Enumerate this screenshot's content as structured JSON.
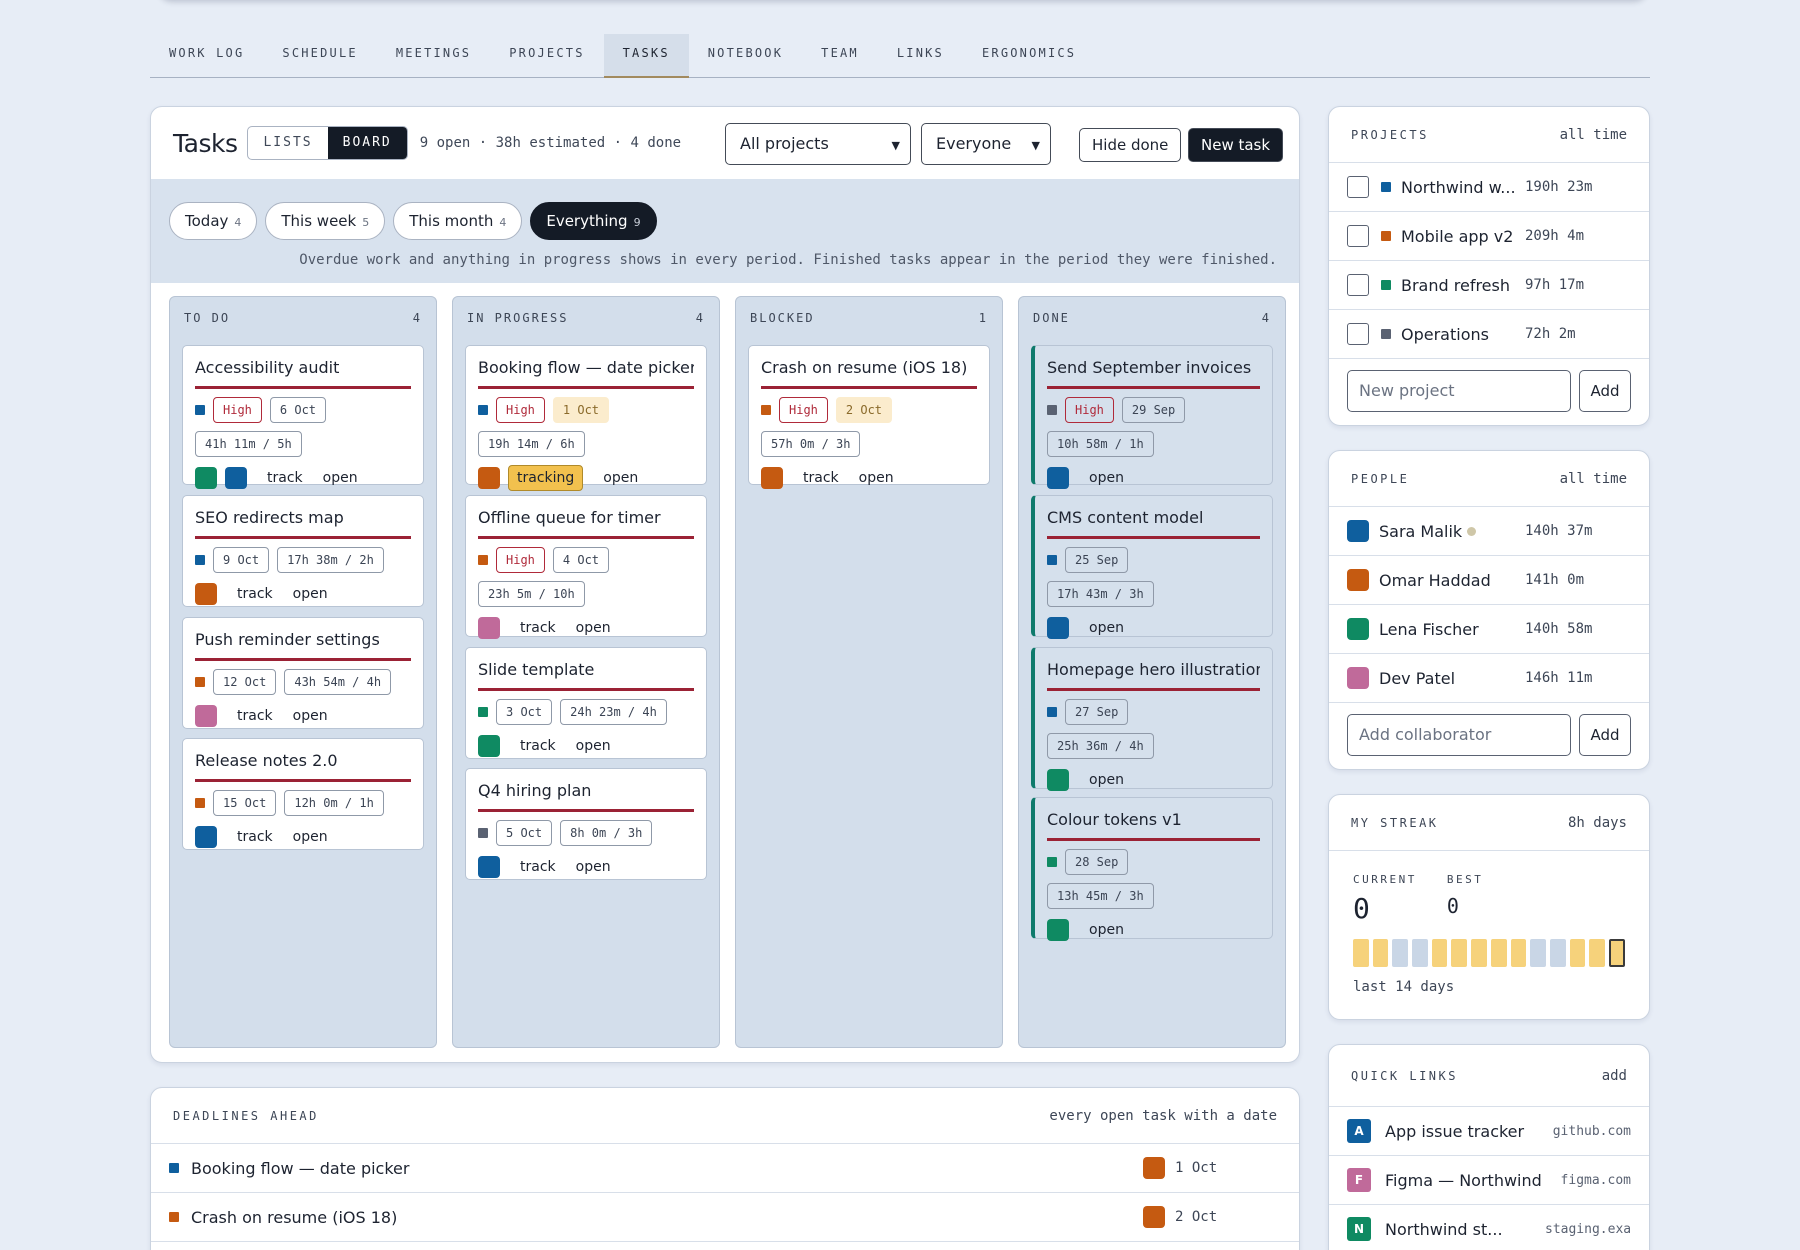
{
  "nav": [
    "WORK LOG",
    "SCHEDULE",
    "MEETINGS",
    "PROJECTS",
    "TASKS",
    "NOTEBOOK",
    "TEAM",
    "LINKS",
    "ERGONOMICS"
  ],
  "nav_active": "TASKS",
  "tasks": {
    "title": "Tasks",
    "view_lists": "LISTS",
    "view_board": "BOARD",
    "summary": "9 open · 38h estimated · 4 done",
    "project_select": "All projects",
    "people_select": "Everyone",
    "hide_done": "Hide done",
    "new_task": "New task",
    "pills": [
      {
        "label": "Today",
        "count": "4"
      },
      {
        "label": "This week",
        "count": "5"
      },
      {
        "label": "This month",
        "count": "4"
      },
      {
        "label": "Everything",
        "count": "9"
      }
    ],
    "note": "Overdue work and anything in progress shows in every period. Finished tasks appear in the period they were finished."
  },
  "columns": [
    {
      "name": "TO DO",
      "count": "4",
      "cards": [
        {
          "title": "Accessibility audit",
          "project_color": "#0f5f9e",
          "priority": "High",
          "date": "6 Oct",
          "time": "41h 11m / 5h",
          "avatars": [
            "#0f8a62",
            "#0f5f9e"
          ],
          "track": "track",
          "open": "open"
        },
        {
          "title": "SEO redirects map",
          "project_color": "#0f5f9e",
          "date": "9 Oct",
          "time": "17h 38m / 2h",
          "avatars": [
            "#c55a11"
          ],
          "track": "track",
          "open": "open"
        },
        {
          "title": "Push reminder settings",
          "project_color": "#c55a11",
          "date": "12 Oct",
          "time": "43h 54m / 4h",
          "avatars": [
            "#c06a9a"
          ],
          "track": "track",
          "open": "open"
        },
        {
          "title": "Release notes 2.0",
          "project_color": "#c55a11",
          "date": "15 Oct",
          "time": "12h 0m / 1h",
          "avatars": [
            "#0f5f9e"
          ],
          "track": "track",
          "open": "open"
        }
      ]
    },
    {
      "name": "IN PROGRESS",
      "count": "4",
      "cards": [
        {
          "title": "Booking flow — date picker",
          "project_color": "#0f5f9e",
          "priority": "High",
          "date": "1 Oct",
          "date_warn": true,
          "time": "19h 14m / 6h",
          "avatars": [
            "#c55a11"
          ],
          "tracking": "tracking",
          "open": "open"
        },
        {
          "title": "Offline queue for timer",
          "project_color": "#c55a11",
          "priority": "High",
          "date": "4 Oct",
          "time": "23h 5m / 10h",
          "avatars": [
            "#c06a9a"
          ],
          "track": "track",
          "open": "open"
        },
        {
          "title": "Slide template",
          "project_color": "#0f8a62",
          "date": "3 Oct",
          "time": "24h 23m / 4h",
          "avatars": [
            "#0f8a62"
          ],
          "track": "track",
          "open": "open"
        },
        {
          "title": "Q4 hiring plan",
          "project_color": "#5a6272",
          "date": "5 Oct",
          "time": "8h 0m / 3h",
          "avatars": [
            "#0f5f9e"
          ],
          "track": "track",
          "open": "open"
        }
      ]
    },
    {
      "name": "BLOCKED",
      "count": "1",
      "cards": [
        {
          "title": "Crash on resume (iOS 18)",
          "project_color": "#c55a11",
          "priority": "High",
          "date": "2 Oct",
          "date_warn": true,
          "time": "57h 0m / 3h",
          "avatars": [
            "#c55a11"
          ],
          "track": "track",
          "open": "open"
        }
      ]
    },
    {
      "name": "DONE",
      "count": "4",
      "cards": [
        {
          "title": "Send September invoices",
          "project_color": "#5a6272",
          "priority": "High",
          "date": "29 Sep",
          "time": "10h 58m / 1h",
          "avatars": [
            "#0f5f9e"
          ],
          "open": "open"
        },
        {
          "title": "CMS content model",
          "project_color": "#0f5f9e",
          "date": "25 Sep",
          "time": "17h 43m / 3h",
          "avatars": [
            "#0f5f9e"
          ],
          "open": "open"
        },
        {
          "title": "Homepage hero illustration",
          "project_color": "#0f5f9e",
          "date": "27 Sep",
          "time": "25h 36m / 4h",
          "avatars": [
            "#0f8a62"
          ],
          "open": "open"
        },
        {
          "title": "Colour tokens v1",
          "project_color": "#0f8a62",
          "date": "28 Sep",
          "time": "13h 45m / 3h",
          "avatars": [
            "#0f8a62"
          ],
          "open": "open"
        }
      ]
    }
  ],
  "projects": {
    "header": "PROJECTS",
    "scope": "all time",
    "items": [
      {
        "name": "Northwind w...",
        "color": "#0f5f9e",
        "hours": "190h 23m"
      },
      {
        "name": "Mobile app v2",
        "color": "#c55a11",
        "hours": "209h 4m"
      },
      {
        "name": "Brand refresh",
        "color": "#0f8a62",
        "hours": "97h 17m"
      },
      {
        "name": "Operations",
        "color": "#5a6272",
        "hours": "72h 2m"
      }
    ],
    "placeholder": "New project",
    "add": "Add"
  },
  "people": {
    "header": "PEOPLE",
    "scope": "all time",
    "items": [
      {
        "name": "Sara Malik",
        "color": "#0f5f9e",
        "hours": "140h 37m",
        "online": true
      },
      {
        "name": "Omar Haddad",
        "color": "#c55a11",
        "hours": "141h 0m"
      },
      {
        "name": "Lena Fischer",
        "color": "#0f8a62",
        "hours": "140h 58m"
      },
      {
        "name": "Dev Patel",
        "color": "#c06a9a",
        "hours": "146h 11m"
      }
    ],
    "placeholder": "Add collaborator",
    "add": "Add"
  },
  "streak": {
    "header": "MY STREAK",
    "scope": "8h days",
    "current_label": "CURRENT",
    "best_label": "BEST",
    "current": "0",
    "best": "0",
    "caption": "last 14 days",
    "days": [
      "hit",
      "hit",
      "miss",
      "miss",
      "hit",
      "hit",
      "hit",
      "hit",
      "hit",
      "miss",
      "miss",
      "hit",
      "hit",
      "today"
    ]
  },
  "quicklinks": {
    "header": "QUICK LINKS",
    "add": "add",
    "items": [
      {
        "letter": "A",
        "name": "App issue tracker",
        "domain": "github.com",
        "color": "#0f5f9e"
      },
      {
        "letter": "F",
        "name": "Figma — Northwind",
        "domain": "figma.com",
        "color": "#c06a9a"
      },
      {
        "letter": "N",
        "name": "Northwind st...",
        "domain": "staging.exa...",
        "color": "#0f8a62"
      }
    ]
  },
  "deadlines": {
    "header": "DEADLINES AHEAD",
    "scope": "every open task with a date",
    "items": [
      {
        "title": "Booking flow — date picker",
        "color": "#0f5f9e",
        "avatar": "#c55a11",
        "date": "1 Oct"
      },
      {
        "title": "Crash on resume (iOS 18)",
        "color": "#c55a11",
        "avatar": "#c55a11",
        "date": "2 Oct"
      }
    ]
  }
}
